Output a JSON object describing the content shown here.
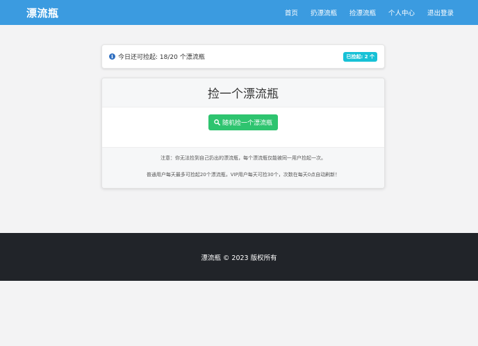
{
  "nav": {
    "brand": "漂流瓶",
    "links": [
      "首页",
      "扔漂流瓶",
      "捡漂流瓶",
      "个人中心",
      "退出登录"
    ]
  },
  "info": {
    "remaining_text": "今日还可捡起: 18/20 个漂流瓶",
    "badge": "已捡起: 2 个"
  },
  "pick": {
    "title": "捡一个漂流瓶",
    "button_label": "随机捡一个漂流瓶",
    "notes": [
      "注意：你无法捡到自己扔出的漂流瓶，每个漂流瓶仅能被同一用户捡起一次。",
      "普通用户每天最多可捡起20个漂流瓶，VIP用户每天可捡30个，次数在每天0点自动刷新！"
    ]
  },
  "footer": {
    "text": "漂流瓶 © 2023 版权所有"
  },
  "colors": {
    "navbar": "#3b9be0",
    "button": "#2ec46f",
    "badge": "#17c1d6",
    "footer": "#212429"
  }
}
